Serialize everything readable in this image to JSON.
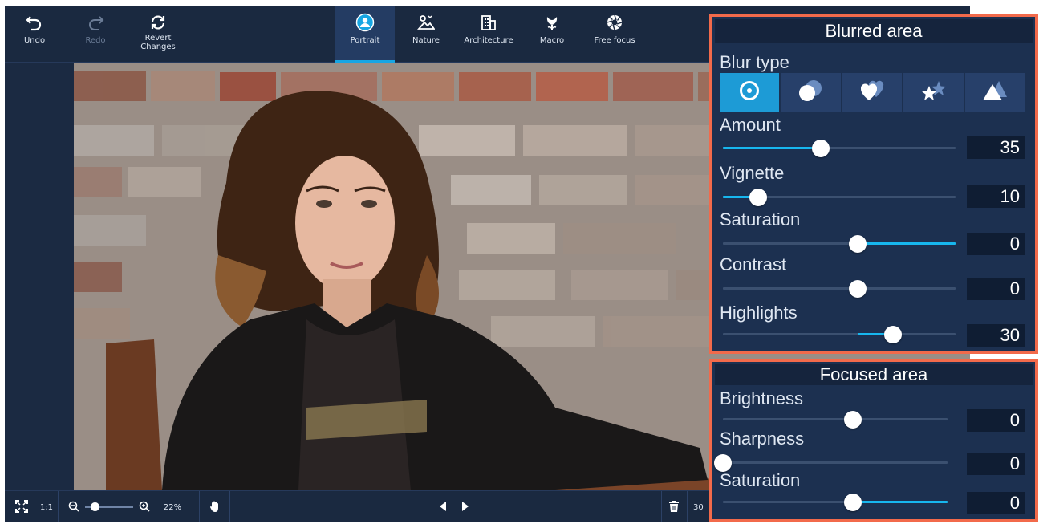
{
  "toolbar": {
    "undo_label": "Undo",
    "redo_label": "Redo",
    "revert_label": "Revert\nChanges",
    "modes": [
      {
        "label": "Portrait",
        "icon": "portrait-icon",
        "active": true
      },
      {
        "label": "Nature",
        "icon": "nature-icon",
        "active": false
      },
      {
        "label": "Architecture",
        "icon": "architecture-icon",
        "active": false
      },
      {
        "label": "Macro",
        "icon": "macro-icon",
        "active": false
      },
      {
        "label": "Free focus",
        "icon": "aperture-icon",
        "active": false
      }
    ]
  },
  "bottombar": {
    "one_to_one": "1:1",
    "zoom_percent": "22%",
    "zoom_level": 0.2,
    "clipped_text": "30"
  },
  "blurred_area": {
    "title": "Blurred area",
    "blur_type_label": "Blur type",
    "blur_types": [
      "circle-bokeh-icon",
      "overlap-circles-icon",
      "hearts-icon",
      "stars-icon",
      "triangles-icon"
    ],
    "active_blur_type": 0,
    "sliders": {
      "amount": {
        "label": "Amount",
        "value": "35",
        "level": 0.42
      },
      "vignette": {
        "label": "Vignette",
        "value": "10",
        "level": 0.15
      },
      "saturation": {
        "label": "Saturation",
        "value": "0",
        "level": 0.58
      },
      "contrast": {
        "label": "Contrast",
        "value": "0",
        "level": 0.58
      },
      "highlights": {
        "label": "Highlights",
        "value": "30",
        "level": 0.73
      }
    }
  },
  "focused_area": {
    "title": "Focused area",
    "sliders": {
      "brightness": {
        "label": "Brightness",
        "value": "0",
        "level": 0.58
      },
      "sharpness": {
        "label": "Sharpness",
        "value": "0",
        "level": 0.0
      },
      "saturation": {
        "label": "Saturation",
        "value": "0",
        "level": 0.58
      }
    }
  },
  "colors": {
    "accent": "#17a6e3",
    "highlight_frame": "#f26a4b",
    "panel_bg": "#1c3050",
    "toolbar_bg": "#1a2940"
  }
}
